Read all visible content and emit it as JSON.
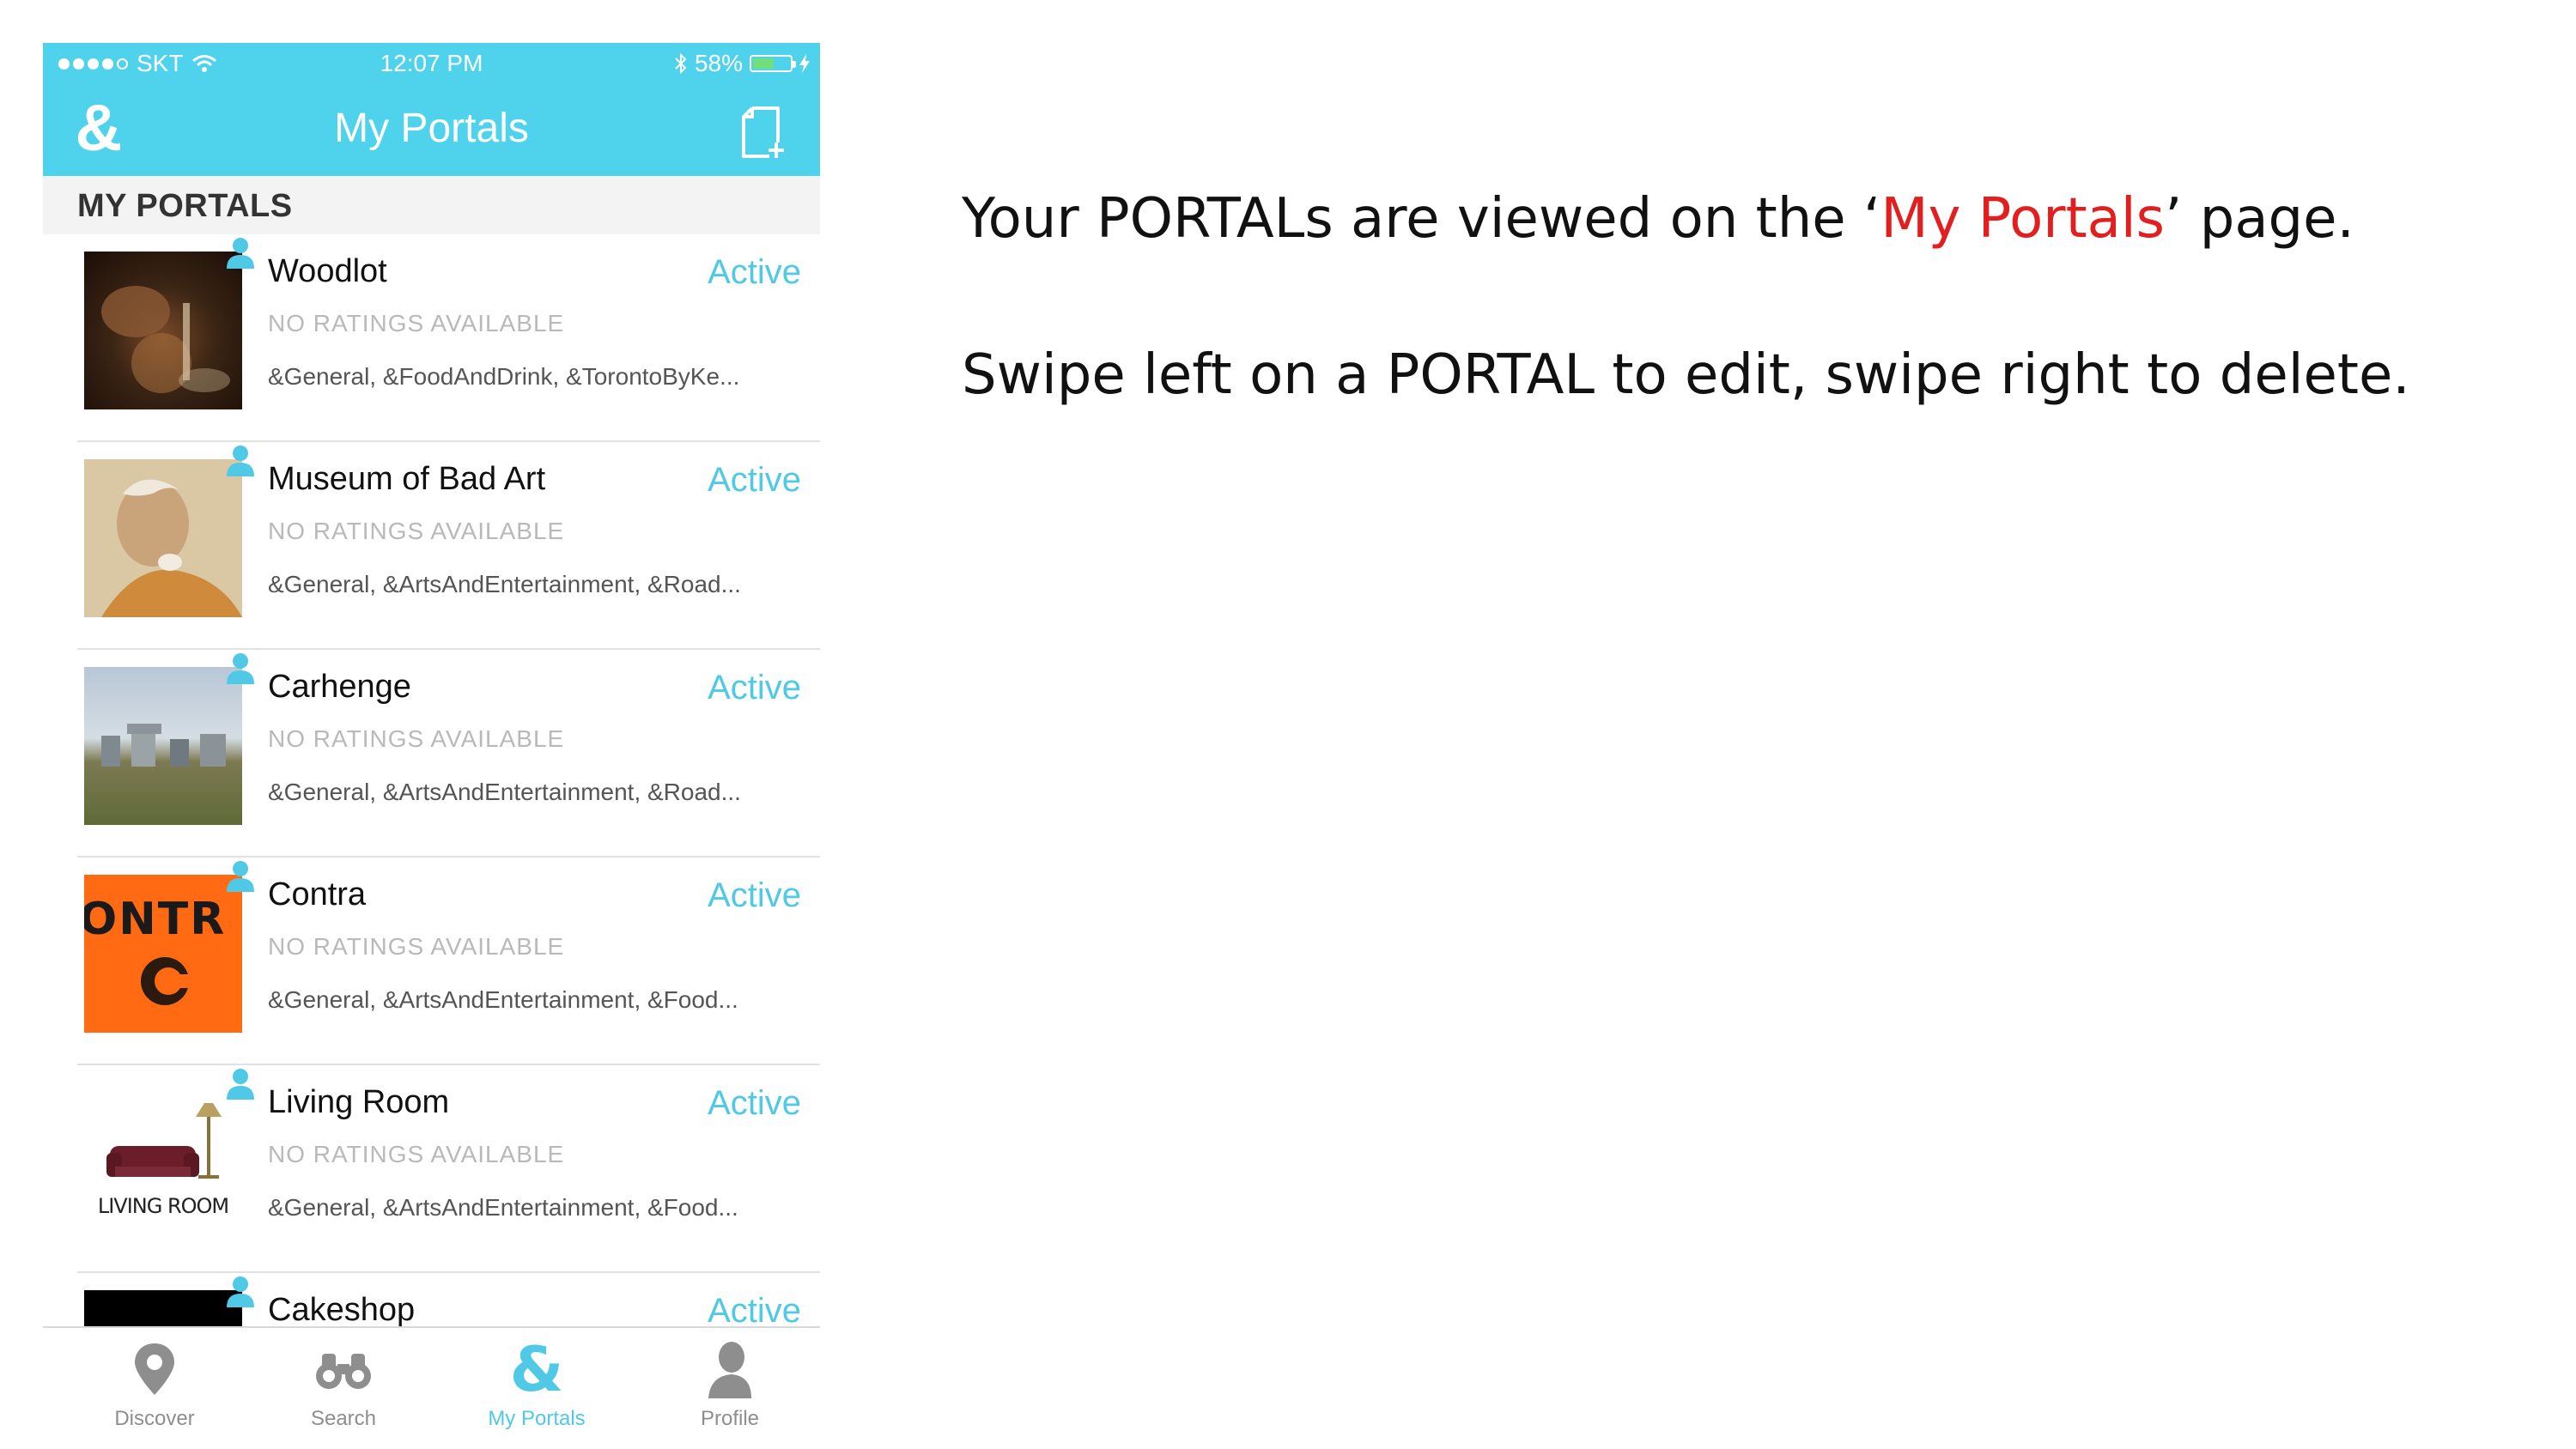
{
  "status_bar": {
    "carrier": "SKT",
    "time": "12:07 PM",
    "battery": "58%",
    "battery_level": 0.58
  },
  "nav": {
    "logo": "&",
    "title": "My Portals",
    "new_portal_icon": "new-document-icon"
  },
  "section": {
    "header": "MY PORTALS"
  },
  "portals": [
    {
      "title": "Woodlot",
      "status": "Active",
      "rating": "NO RATINGS AVAILABLE",
      "tags": "&General, &FoodAndDrink, &TorontoByKe..."
    },
    {
      "title": "Museum of Bad Art",
      "status": "Active",
      "rating": "NO RATINGS AVAILABLE",
      "tags": "&General, &ArtsAndEntertainment, &Road..."
    },
    {
      "title": "Carhenge",
      "status": "Active",
      "rating": "NO RATINGS AVAILABLE",
      "tags": "&General, &ArtsAndEntertainment, &Road..."
    },
    {
      "title": "Contra",
      "status": "Active",
      "rating": "NO RATINGS AVAILABLE",
      "tags": "&General, &ArtsAndEntertainment, &Food...",
      "thumb_text": "ONTR"
    },
    {
      "title": "Living Room",
      "status": "Active",
      "rating": "NO RATINGS AVAILABLE",
      "tags": "&General, &ArtsAndEntertainment, &Food...",
      "thumb_text": "LIVING ROOM"
    },
    {
      "title": "Cakeshop",
      "status": "Active",
      "rating": "",
      "tags": ""
    }
  ],
  "tabs": [
    {
      "label": "Discover",
      "icon": "map-pin-icon"
    },
    {
      "label": "Search",
      "icon": "binoculars-icon"
    },
    {
      "label": "My Portals",
      "icon": "ampersand-icon",
      "active": true
    },
    {
      "label": "Profile",
      "icon": "person-icon"
    }
  ],
  "caption": {
    "line1_before": "Your PORTALs are viewed on the ‘",
    "line1_highlight": "My Portals",
    "line1_after": "’ page.",
    "line2": "Swipe left on a PORTAL to edit, swipe right to delete.",
    "highlight_color": "#e31e1e"
  },
  "colors": {
    "accent": "#4fd3ec",
    "active_text": "#4fc9e6"
  }
}
